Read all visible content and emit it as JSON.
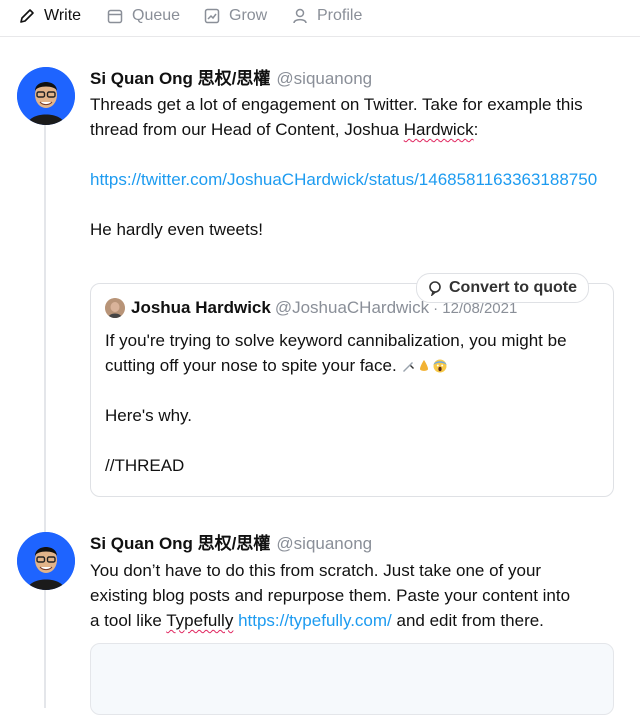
{
  "nav": {
    "write": "Write",
    "queue": "Queue",
    "grow": "Grow",
    "profile": "Profile"
  },
  "tweets": [
    {
      "name": "Si Quan Ong 思权/思權",
      "handle": "@siquanong",
      "line1": "Threads get a lot of engagement on Twitter. Take for example this",
      "line2_pre": "thread from our Head of Content, Joshua ",
      "line2_word": "Hardwick",
      "line2_post": ":",
      "link": "https://twitter.com/JoshuaCHardwick/status/1468581163363188750",
      "after": "He hardly even tweets!"
    },
    {
      "name": "Si Quan Ong 思权/思權",
      "handle": "@siquanong",
      "line1": "You don’t have to do this from scratch. Just take one of your",
      "line2": "existing blog posts and repurpose them. Paste your content into",
      "line3_pre": "a tool like ",
      "line3_word": "Typefully",
      "line3_link": "https://typefully.com/",
      "line3_post": " and edit from there."
    }
  ],
  "quote": {
    "convert_label": "Convert to quote",
    "name": "Joshua Hardwick",
    "handle": "@JoshuaCHardwick",
    "date": "· 12/08/2021",
    "line1": "If you're trying to solve keyword cannibalization, you might be",
    "line2": "cutting off your nose to spite your face.",
    "p2": "Here's why.",
    "p3": "//THREAD",
    "emojis": [
      "knife",
      "nose",
      "screaming-face"
    ]
  },
  "colors": {
    "link": "#1d9bf0",
    "avatar_bg": "#1e64ff",
    "muted": "#8a8f98"
  }
}
